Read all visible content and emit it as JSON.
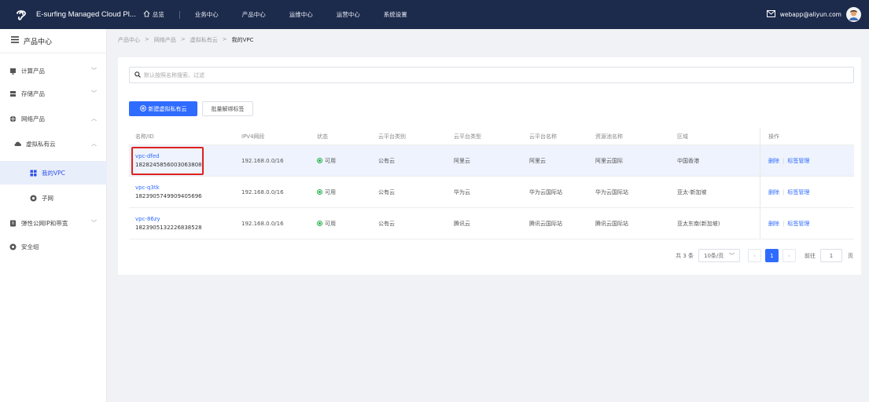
{
  "header": {
    "app_title": "E-surfing Managed Cloud Pl...",
    "home_label": "总览",
    "nav": [
      "业务中心",
      "产品中心",
      "运维中心",
      "运营中心",
      "系统设置"
    ],
    "user_email": "webapp@aliyun.com"
  },
  "sidebar": {
    "title": "产品中心",
    "items": [
      {
        "label": "计算产品",
        "icon": "compute-icon"
      },
      {
        "label": "存储产品",
        "icon": "storage-icon"
      },
      {
        "label": "网络产品",
        "icon": "network-icon"
      },
      {
        "label": "虚拟私有云",
        "icon": "cloud-icon"
      },
      {
        "label": "我的VPC",
        "icon": "vpc-icon"
      },
      {
        "label": "子网",
        "icon": "subnet-icon"
      },
      {
        "label": "弹性公网IP和带宽",
        "icon": "eip-icon"
      },
      {
        "label": "安全组",
        "icon": "security-group-icon"
      }
    ]
  },
  "breadcrumb": [
    "产品中心",
    "网络产品",
    "虚拟私有云",
    "我的VPC"
  ],
  "toolbar": {
    "search_placeholder": "默认按照名称搜索、过滤",
    "create_label": "新建虚拟私有云",
    "unbind_label": "批量解绑标签"
  },
  "table": {
    "columns": [
      "名称/ID",
      "IPV4网段",
      "状态",
      "云平台类别",
      "云平台类型",
      "云平台名称",
      "资源池名称",
      "区域",
      "操作"
    ],
    "rows": [
      {
        "name": "vpc-dfed",
        "id": "1828245856003063808",
        "cidr": "192.168.0.0/16",
        "status": "可用",
        "category": "公有云",
        "type": "阿里云",
        "platform": "阿里云",
        "pool": "阿里云国际",
        "region": "中国香港"
      },
      {
        "name": "vpc-q3tk",
        "id": "1823905749909405696",
        "cidr": "192.168.0.0/16",
        "status": "可用",
        "category": "公有云",
        "type": "华为云",
        "platform": "华为云国际站",
        "pool": "华为云国际站",
        "region": "亚太-新加坡"
      },
      {
        "name": "vpc-86zy",
        "id": "1823905132226838528",
        "cidr": "192.168.0.0/16",
        "status": "可用",
        "category": "公有云",
        "type": "腾讯云",
        "platform": "腾讯云国际站",
        "pool": "腾讯云国际站",
        "region": "亚太东南(新加坡)"
      }
    ],
    "op_delete": "删除",
    "op_tags": "标签管理"
  },
  "pagination": {
    "total": "共 3 条",
    "page_size": "10条/页",
    "current": "1",
    "goto_label": "前往",
    "goto_value": "1",
    "page_unit": "页"
  },
  "colors": {
    "topbar": "#1c2a4b",
    "primary": "#2f6bff",
    "status_ok": "#27b04a",
    "highlight": "#e02020"
  }
}
